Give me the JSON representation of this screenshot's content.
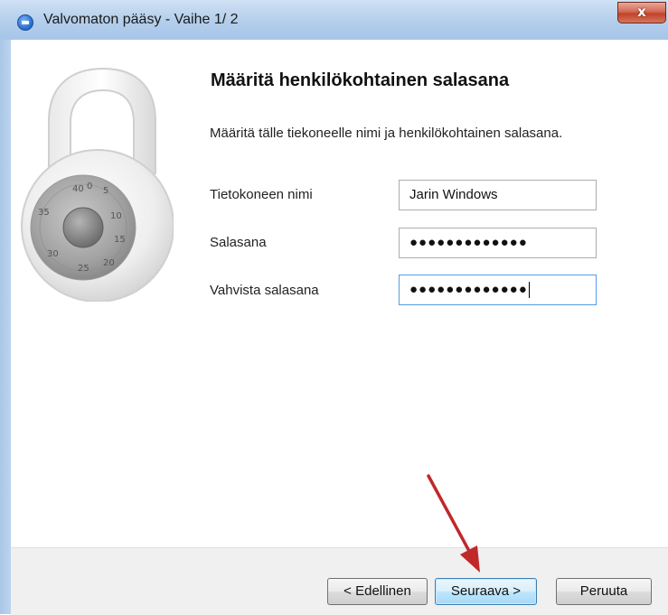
{
  "window": {
    "title": "Valvomaton pääsy - Vaihe 1/ 2",
    "close_label": "x"
  },
  "main": {
    "heading": "Määritä henkilökohtainen salasana",
    "description": "Määritä tälle tiekoneelle nimi ja henkilökohtainen salasana.",
    "fields": {
      "computer_name": {
        "label": "Tietokoneen nimi",
        "value": "Jarin Windows"
      },
      "password": {
        "label": "Salasana",
        "value": "●●●●●●●●●●●●●"
      },
      "confirm_password": {
        "label": "Vahvista salasana",
        "value": "●●●●●●●●●●●●●"
      }
    },
    "padlock_dial_numbers": [
      "0",
      "5",
      "10",
      "15",
      "20",
      "25",
      "30",
      "35",
      "40"
    ]
  },
  "buttons": {
    "back": "< Edellinen",
    "next": "Seuraava >",
    "cancel": "Peruuta"
  },
  "colors": {
    "annotation_arrow": "#c0282a",
    "frame": "#a9c6e6",
    "close_button": "#c0432a"
  },
  "icons": [
    "teamviewer-app-icon",
    "padlock-icon",
    "close-icon",
    "annotation-arrow-icon"
  ]
}
